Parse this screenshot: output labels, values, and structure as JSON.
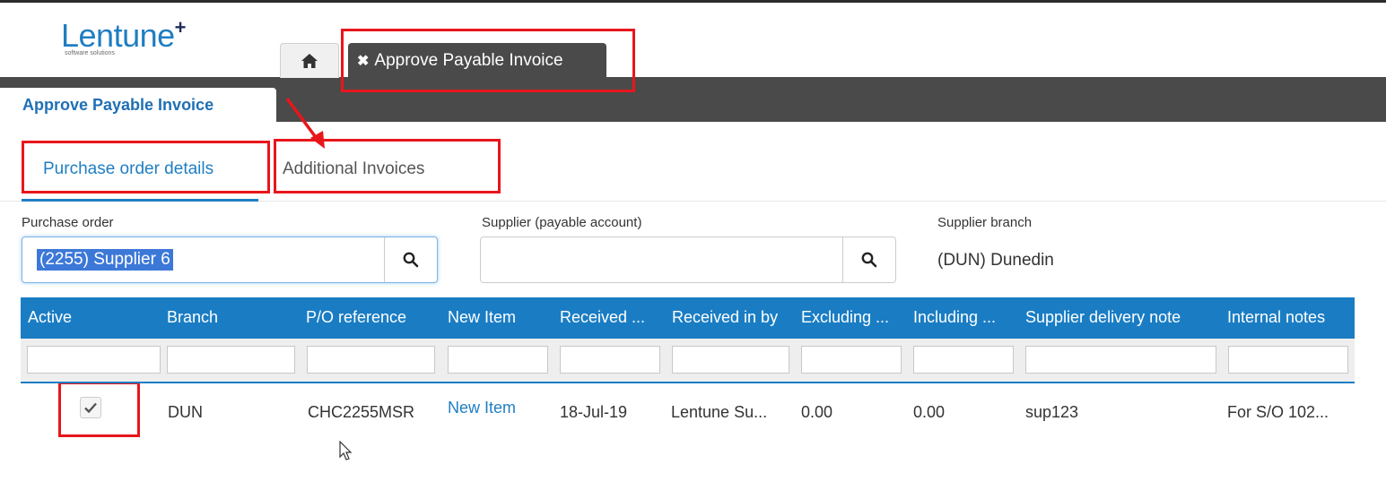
{
  "app": {
    "logo_text": "Lentune",
    "logo_plus": "+",
    "logo_subtitle": "software solutions"
  },
  "tabs": {
    "home_icon": "home-icon",
    "active_tab_close": "✖",
    "active_tab_label": "Approve Payable Invoice"
  },
  "page": {
    "tab_label": "Approve Payable Invoice"
  },
  "subtabs": [
    {
      "label": "Purchase order details",
      "active": true
    },
    {
      "label": "Additional Invoices",
      "active": false
    }
  ],
  "form": {
    "purchase_order_label": "Purchase order",
    "purchase_order_value": "(2255) Supplier 6",
    "supplier_label": "Supplier (payable account)",
    "supplier_value": "",
    "supplier_branch_label": "Supplier branch",
    "supplier_branch_value": "(DUN) Dunedin"
  },
  "grid": {
    "columns": [
      "Active",
      "Branch",
      "P/O reference",
      "New Item",
      "Received ...",
      "Received in by",
      "Excluding ...",
      "Including ...",
      "Supplier delivery note",
      "Internal notes"
    ],
    "rows": [
      {
        "active": true,
        "branch": "DUN",
        "po_reference": "CHC2255MSR",
        "new_item": "New Item",
        "received": "18-Jul-19",
        "received_in_by": "Lentune Su...",
        "excluding": "0.00",
        "including": "0.00",
        "supplier_delivery_note": "sup123",
        "internal_notes": "For S/O 102..."
      }
    ]
  },
  "colors": {
    "accent": "#1a7dc4",
    "dark_bar": "#4a4a4a",
    "highlight_red": "#e8161b"
  }
}
